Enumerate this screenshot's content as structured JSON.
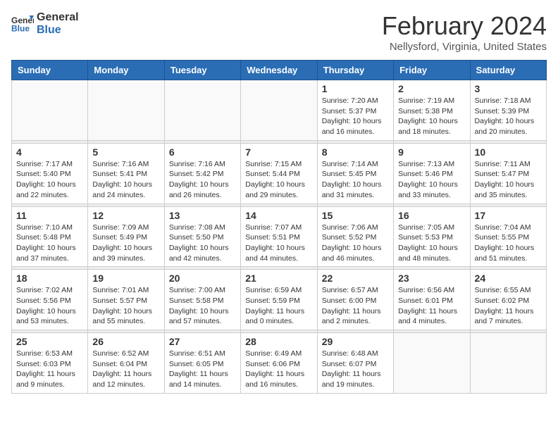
{
  "logo": {
    "text_general": "General",
    "text_blue": "Blue"
  },
  "title": "February 2024",
  "subtitle": "Nellysford, Virginia, United States",
  "days_of_week": [
    "Sunday",
    "Monday",
    "Tuesday",
    "Wednesday",
    "Thursday",
    "Friday",
    "Saturday"
  ],
  "weeks": [
    [
      {
        "day": "",
        "info": ""
      },
      {
        "day": "",
        "info": ""
      },
      {
        "day": "",
        "info": ""
      },
      {
        "day": "",
        "info": ""
      },
      {
        "day": "1",
        "info": "Sunrise: 7:20 AM\nSunset: 5:37 PM\nDaylight: 10 hours\nand 16 minutes."
      },
      {
        "day": "2",
        "info": "Sunrise: 7:19 AM\nSunset: 5:38 PM\nDaylight: 10 hours\nand 18 minutes."
      },
      {
        "day": "3",
        "info": "Sunrise: 7:18 AM\nSunset: 5:39 PM\nDaylight: 10 hours\nand 20 minutes."
      }
    ],
    [
      {
        "day": "4",
        "info": "Sunrise: 7:17 AM\nSunset: 5:40 PM\nDaylight: 10 hours\nand 22 minutes."
      },
      {
        "day": "5",
        "info": "Sunrise: 7:16 AM\nSunset: 5:41 PM\nDaylight: 10 hours\nand 24 minutes."
      },
      {
        "day": "6",
        "info": "Sunrise: 7:16 AM\nSunset: 5:42 PM\nDaylight: 10 hours\nand 26 minutes."
      },
      {
        "day": "7",
        "info": "Sunrise: 7:15 AM\nSunset: 5:44 PM\nDaylight: 10 hours\nand 29 minutes."
      },
      {
        "day": "8",
        "info": "Sunrise: 7:14 AM\nSunset: 5:45 PM\nDaylight: 10 hours\nand 31 minutes."
      },
      {
        "day": "9",
        "info": "Sunrise: 7:13 AM\nSunset: 5:46 PM\nDaylight: 10 hours\nand 33 minutes."
      },
      {
        "day": "10",
        "info": "Sunrise: 7:11 AM\nSunset: 5:47 PM\nDaylight: 10 hours\nand 35 minutes."
      }
    ],
    [
      {
        "day": "11",
        "info": "Sunrise: 7:10 AM\nSunset: 5:48 PM\nDaylight: 10 hours\nand 37 minutes."
      },
      {
        "day": "12",
        "info": "Sunrise: 7:09 AM\nSunset: 5:49 PM\nDaylight: 10 hours\nand 39 minutes."
      },
      {
        "day": "13",
        "info": "Sunrise: 7:08 AM\nSunset: 5:50 PM\nDaylight: 10 hours\nand 42 minutes."
      },
      {
        "day": "14",
        "info": "Sunrise: 7:07 AM\nSunset: 5:51 PM\nDaylight: 10 hours\nand 44 minutes."
      },
      {
        "day": "15",
        "info": "Sunrise: 7:06 AM\nSunset: 5:52 PM\nDaylight: 10 hours\nand 46 minutes."
      },
      {
        "day": "16",
        "info": "Sunrise: 7:05 AM\nSunset: 5:53 PM\nDaylight: 10 hours\nand 48 minutes."
      },
      {
        "day": "17",
        "info": "Sunrise: 7:04 AM\nSunset: 5:55 PM\nDaylight: 10 hours\nand 51 minutes."
      }
    ],
    [
      {
        "day": "18",
        "info": "Sunrise: 7:02 AM\nSunset: 5:56 PM\nDaylight: 10 hours\nand 53 minutes."
      },
      {
        "day": "19",
        "info": "Sunrise: 7:01 AM\nSunset: 5:57 PM\nDaylight: 10 hours\nand 55 minutes."
      },
      {
        "day": "20",
        "info": "Sunrise: 7:00 AM\nSunset: 5:58 PM\nDaylight: 10 hours\nand 57 minutes."
      },
      {
        "day": "21",
        "info": "Sunrise: 6:59 AM\nSunset: 5:59 PM\nDaylight: 11 hours\nand 0 minutes."
      },
      {
        "day": "22",
        "info": "Sunrise: 6:57 AM\nSunset: 6:00 PM\nDaylight: 11 hours\nand 2 minutes."
      },
      {
        "day": "23",
        "info": "Sunrise: 6:56 AM\nSunset: 6:01 PM\nDaylight: 11 hours\nand 4 minutes."
      },
      {
        "day": "24",
        "info": "Sunrise: 6:55 AM\nSunset: 6:02 PM\nDaylight: 11 hours\nand 7 minutes."
      }
    ],
    [
      {
        "day": "25",
        "info": "Sunrise: 6:53 AM\nSunset: 6:03 PM\nDaylight: 11 hours\nand 9 minutes."
      },
      {
        "day": "26",
        "info": "Sunrise: 6:52 AM\nSunset: 6:04 PM\nDaylight: 11 hours\nand 12 minutes."
      },
      {
        "day": "27",
        "info": "Sunrise: 6:51 AM\nSunset: 6:05 PM\nDaylight: 11 hours\nand 14 minutes."
      },
      {
        "day": "28",
        "info": "Sunrise: 6:49 AM\nSunset: 6:06 PM\nDaylight: 11 hours\nand 16 minutes."
      },
      {
        "day": "29",
        "info": "Sunrise: 6:48 AM\nSunset: 6:07 PM\nDaylight: 11 hours\nand 19 minutes."
      },
      {
        "day": "",
        "info": ""
      },
      {
        "day": "",
        "info": ""
      }
    ]
  ]
}
